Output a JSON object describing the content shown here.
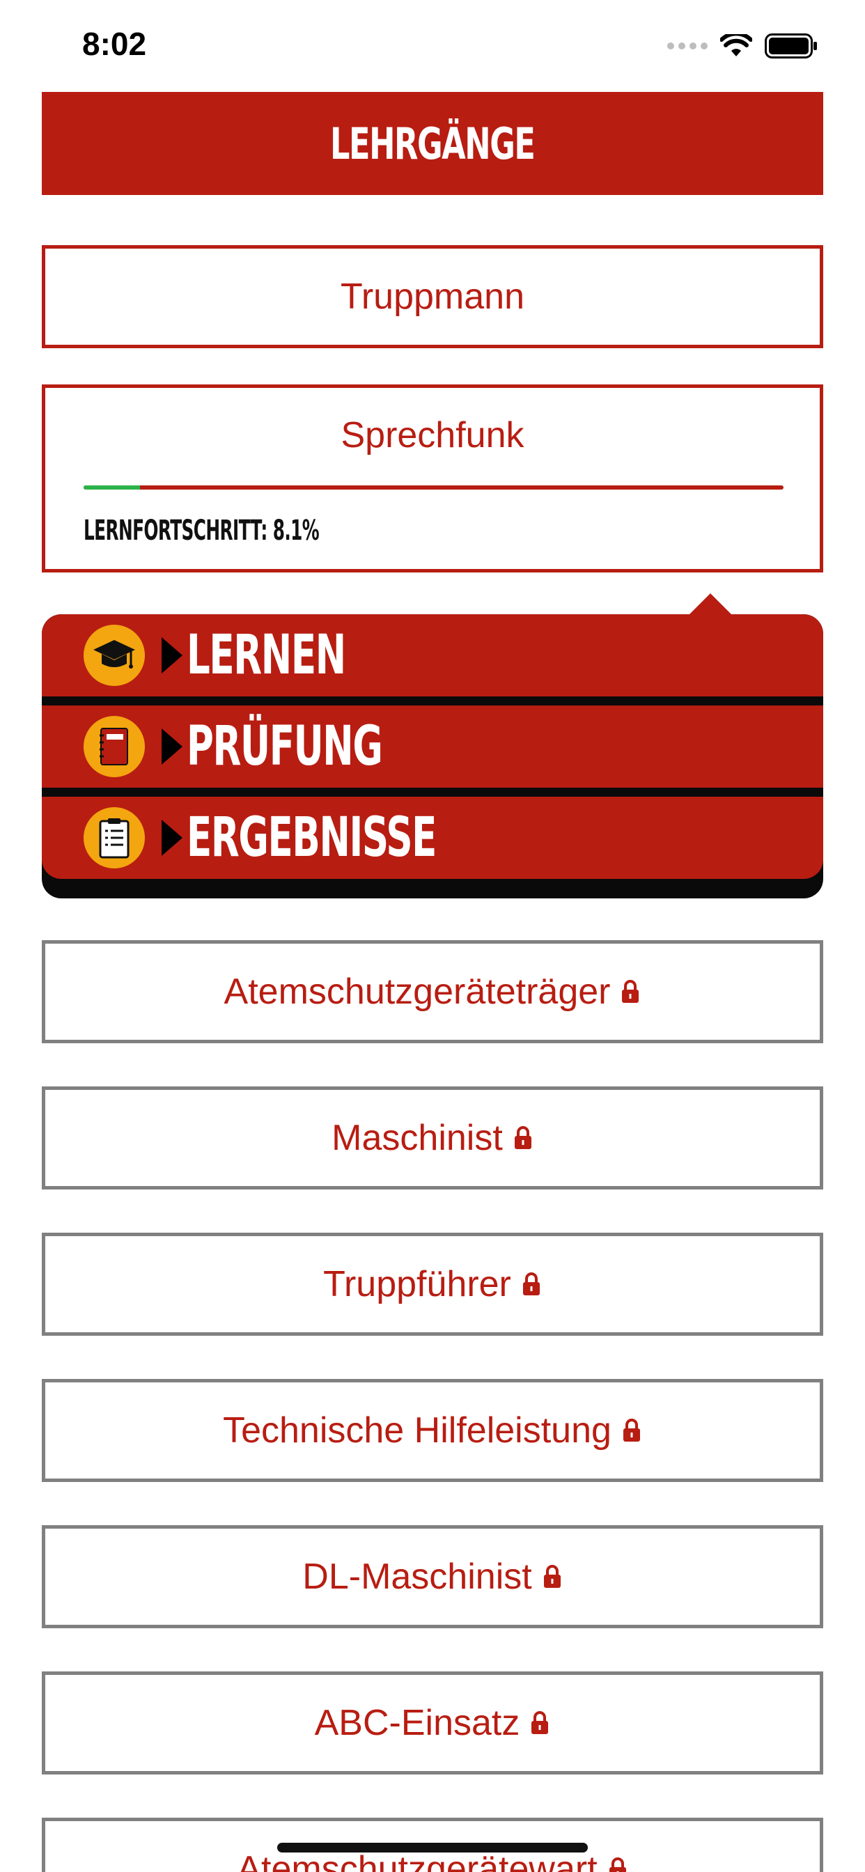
{
  "status_bar": {
    "time": "8:02"
  },
  "header": {
    "title": "LEHRGÄNGE"
  },
  "courses_top": [
    {
      "label": "Truppmann"
    }
  ],
  "expanded_course": {
    "title": "Sprechfunk",
    "progress_label": "LERNFORTSCHRITT: 8.1%",
    "progress_value": 0.081
  },
  "actions": [
    {
      "label": "LERNEN",
      "icon": "graduation-cap-icon"
    },
    {
      "label": "PRÜFUNG",
      "icon": "notebook-icon"
    },
    {
      "label": "ERGEBNISSE",
      "icon": "clipboard-icon"
    }
  ],
  "locked_courses": [
    {
      "label": "Atemschutzgeräteträger"
    },
    {
      "label": "Maschinist"
    },
    {
      "label": "Truppführer"
    },
    {
      "label": "Technische Hilfeleistung"
    },
    {
      "label": "DL-Maschinist"
    },
    {
      "label": "ABC-Einsatz"
    },
    {
      "label": "Atemschutzgerätewart"
    }
  ],
  "colors": {
    "primary_red": "#b81d12",
    "progress_green": "#2bb34a",
    "icon_yellow": "#f3a60f",
    "locked_border": "#808080"
  }
}
